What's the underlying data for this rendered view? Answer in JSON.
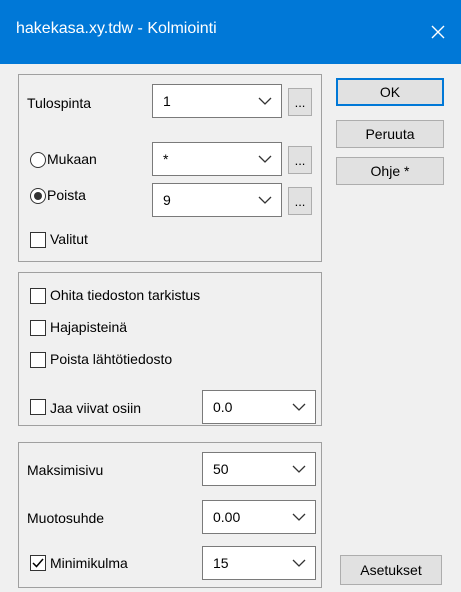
{
  "window": {
    "title": "hakekasa.xy.tdw - Kolmiointi"
  },
  "icons": {
    "close": "close-icon",
    "dropdown": "chevron-down-icon",
    "browse": "ellipsis-icon",
    "check": "checkmark-icon"
  },
  "group1": {
    "tulospinta_label": "Tulospinta",
    "tulospinta_value": "1",
    "mukaan_label": "Mukaan",
    "mukaan_value": "*",
    "mukaan_selected": false,
    "poista_label": "Poista",
    "poista_value": "9",
    "poista_selected": true,
    "valitut_label": "Valitut",
    "valitut_checked": false,
    "browse_label": "..."
  },
  "group2": {
    "ohita_label": "Ohita tiedoston tarkistus",
    "ohita_checked": false,
    "hajapisteina_label": "Hajapisteinä",
    "hajapisteina_checked": false,
    "poista_lahto_label": "Poista lähtötiedosto",
    "poista_lahto_checked": false,
    "jaa_label": "Jaa viivat osiin",
    "jaa_checked": false,
    "jaa_value": "0.0"
  },
  "group3": {
    "maksimisivu_label": "Maksimisivu",
    "maksimisivu_value": "50",
    "muotosuhde_label": "Muotosuhde",
    "muotosuhde_value": "0.00",
    "minimikulma_label": "Minimikulma",
    "minimikulma_checked": true,
    "minimikulma_value": "15"
  },
  "buttons": {
    "ok": "OK",
    "peruuta": "Peruuta",
    "ohje": "Ohje *",
    "asetukset": "Asetukset"
  },
  "colors": {
    "titlebar": "#0078d7",
    "accent": "#0078d7"
  }
}
